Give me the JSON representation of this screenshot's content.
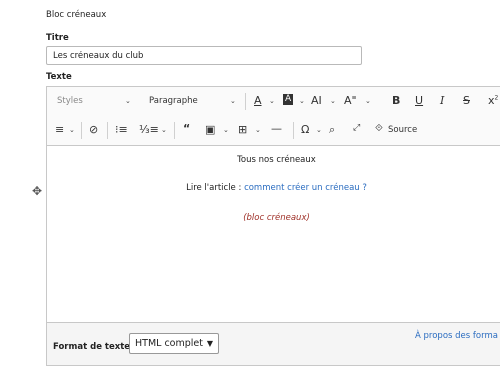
{
  "section_title": "Bloc créneaux",
  "titre": {
    "label": "Titre",
    "value": "Les créneaux du club"
  },
  "texte": {
    "label": "Texte"
  },
  "toolbar": {
    "styles": "Styles",
    "heading": "Paragraphe",
    "source": "Source",
    "icons": [
      "font-color-icon",
      "background-color-icon",
      "font-size-icon",
      "font-family-icon",
      "bold-icon",
      "underline-icon",
      "italic-icon",
      "strikethrough-icon",
      "superscript-icon",
      "align-icon",
      "link-icon",
      "bulleted-list-icon",
      "numbered-list-icon",
      "blockquote-icon",
      "insert-image-icon",
      "table-icon",
      "horizontal-line-icon",
      "special-characters-icon",
      "find-replace-icon",
      "fullscreen-icon",
      "source-icon"
    ]
  },
  "content": {
    "heading": "Tous nos créneaux",
    "article_prefix": "Lire l'article : ",
    "article_link": "comment créer un créneau ?",
    "block_note": "(bloc créneaux)",
    "note_color": "#a0322a",
    "link_color": "#2a6cc0"
  },
  "footer": {
    "format_label": "Format de texte",
    "format_value": "HTML complet",
    "about_link": "À propos des forma"
  }
}
